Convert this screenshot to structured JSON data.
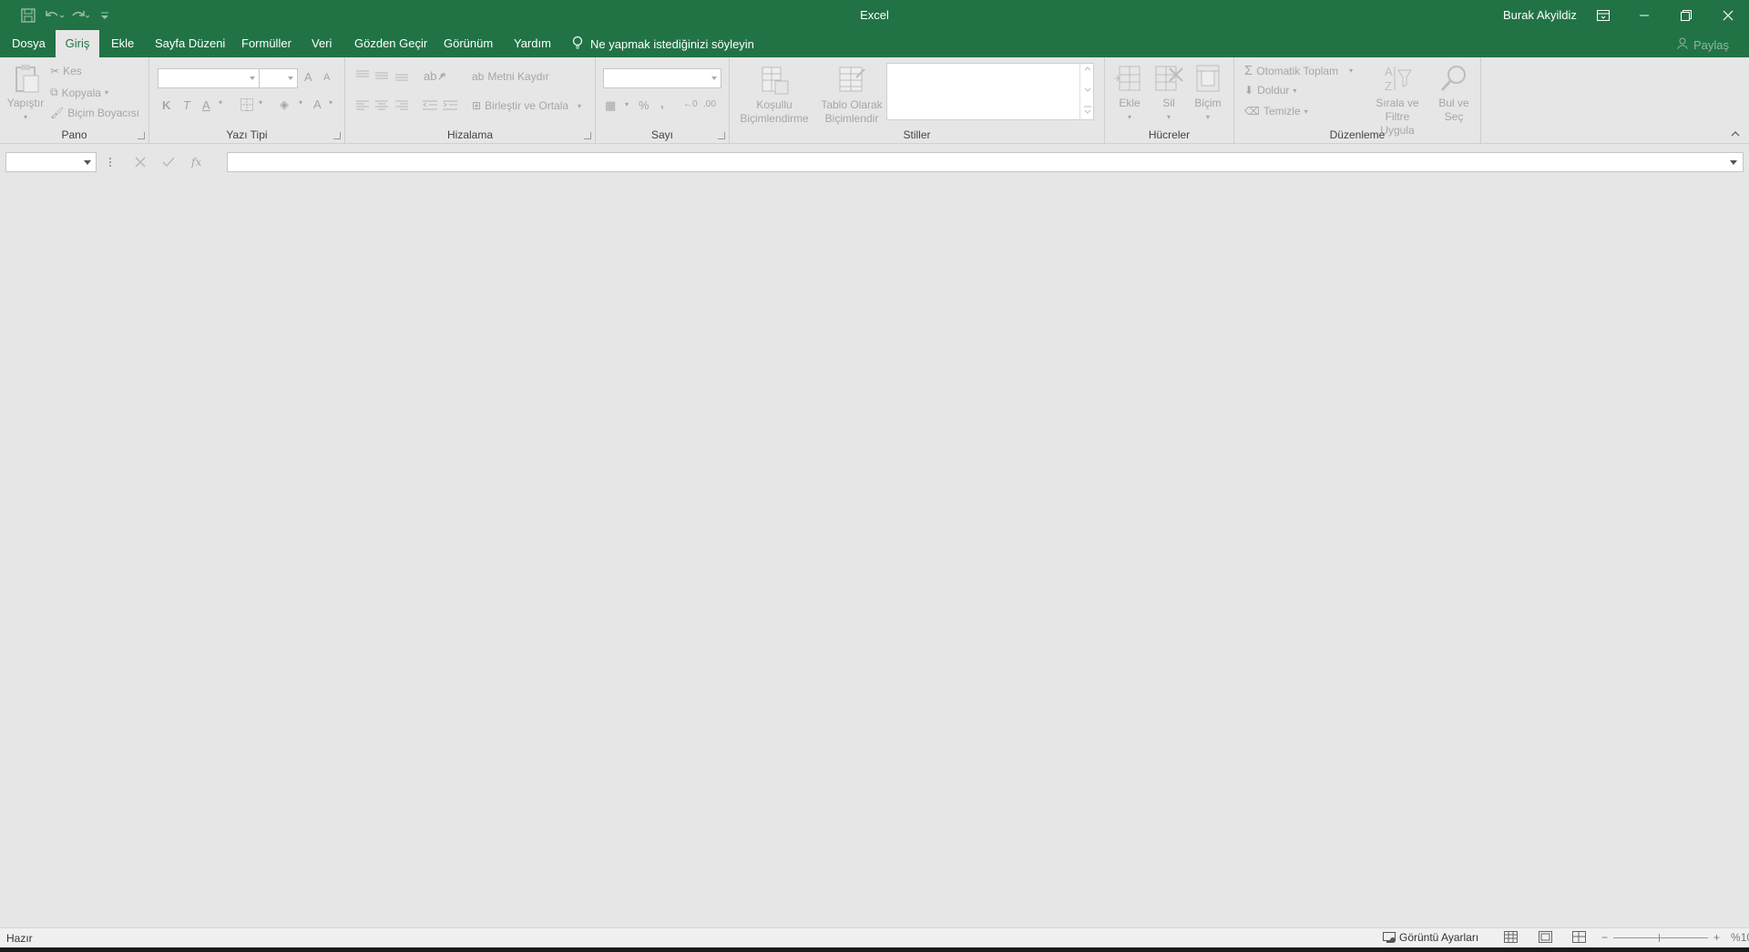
{
  "colors": {
    "accent": "#217346",
    "background": "#e6e6e6",
    "disabled_text": "#a6a6a6"
  },
  "titlebar": {
    "title": "Excel",
    "user": "Burak Akyildiz",
    "qat_icons": [
      "save-icon",
      "undo-icon",
      "redo-icon",
      "customize-qat-icon"
    ],
    "window_icons": [
      "ribbon-display-options-icon",
      "minimize-icon",
      "restore-icon",
      "close-icon"
    ]
  },
  "menu": {
    "tabs": [
      "Dosya",
      "Giriş",
      "Ekle",
      "Sayfa Düzeni",
      "Formüller",
      "Veri",
      "Gözden Geçir",
      "Görünüm",
      "Yardım"
    ],
    "active_tab": "Giriş",
    "tell_me": "Ne yapmak istediğinizi söyleyin",
    "share": "Paylaş"
  },
  "ribbon": {
    "clipboard": {
      "label": "Pano",
      "paste": "Yapıştır",
      "cut": "Kes",
      "copy": "Kopyala",
      "format_painter": "Biçim Boyacısı"
    },
    "font": {
      "label": "Yazı Tipi",
      "font_name": "",
      "font_size": "",
      "bold": "K",
      "italic": "T",
      "underline": "A",
      "grow": "A",
      "shrink": "A",
      "font_color": "A"
    },
    "alignment": {
      "label": "Hizalama",
      "wrap_text": "Metni Kaydır",
      "merge_center": "Birleştir ve Ortala"
    },
    "number": {
      "label": "Sayı",
      "format": "",
      "percent": "%",
      "comma": ","
    },
    "styles": {
      "label": "Stiller",
      "conditional_1": "Koşullu",
      "conditional_2": "Biçimlendirme",
      "table_1": "Tablo Olarak",
      "table_2": "Biçimlendir"
    },
    "cells": {
      "label": "Hücreler",
      "insert": "Ekle",
      "delete": "Sil",
      "format": "Biçim"
    },
    "editing": {
      "label": "Düzenleme",
      "autosum": "Otomatik Toplam",
      "fill": "Doldur",
      "clear": "Temizle",
      "sort_1": "Sırala ve Filtre",
      "sort_2": "Uygula",
      "find_1": "Bul ve",
      "find_2": "Seç"
    }
  },
  "formula_bar": {
    "name_box": "",
    "formula": "",
    "fx": "fx"
  },
  "statusbar": {
    "status": "Hazır",
    "view_settings": "Görüntü Ayarları",
    "zoom": "%10"
  }
}
